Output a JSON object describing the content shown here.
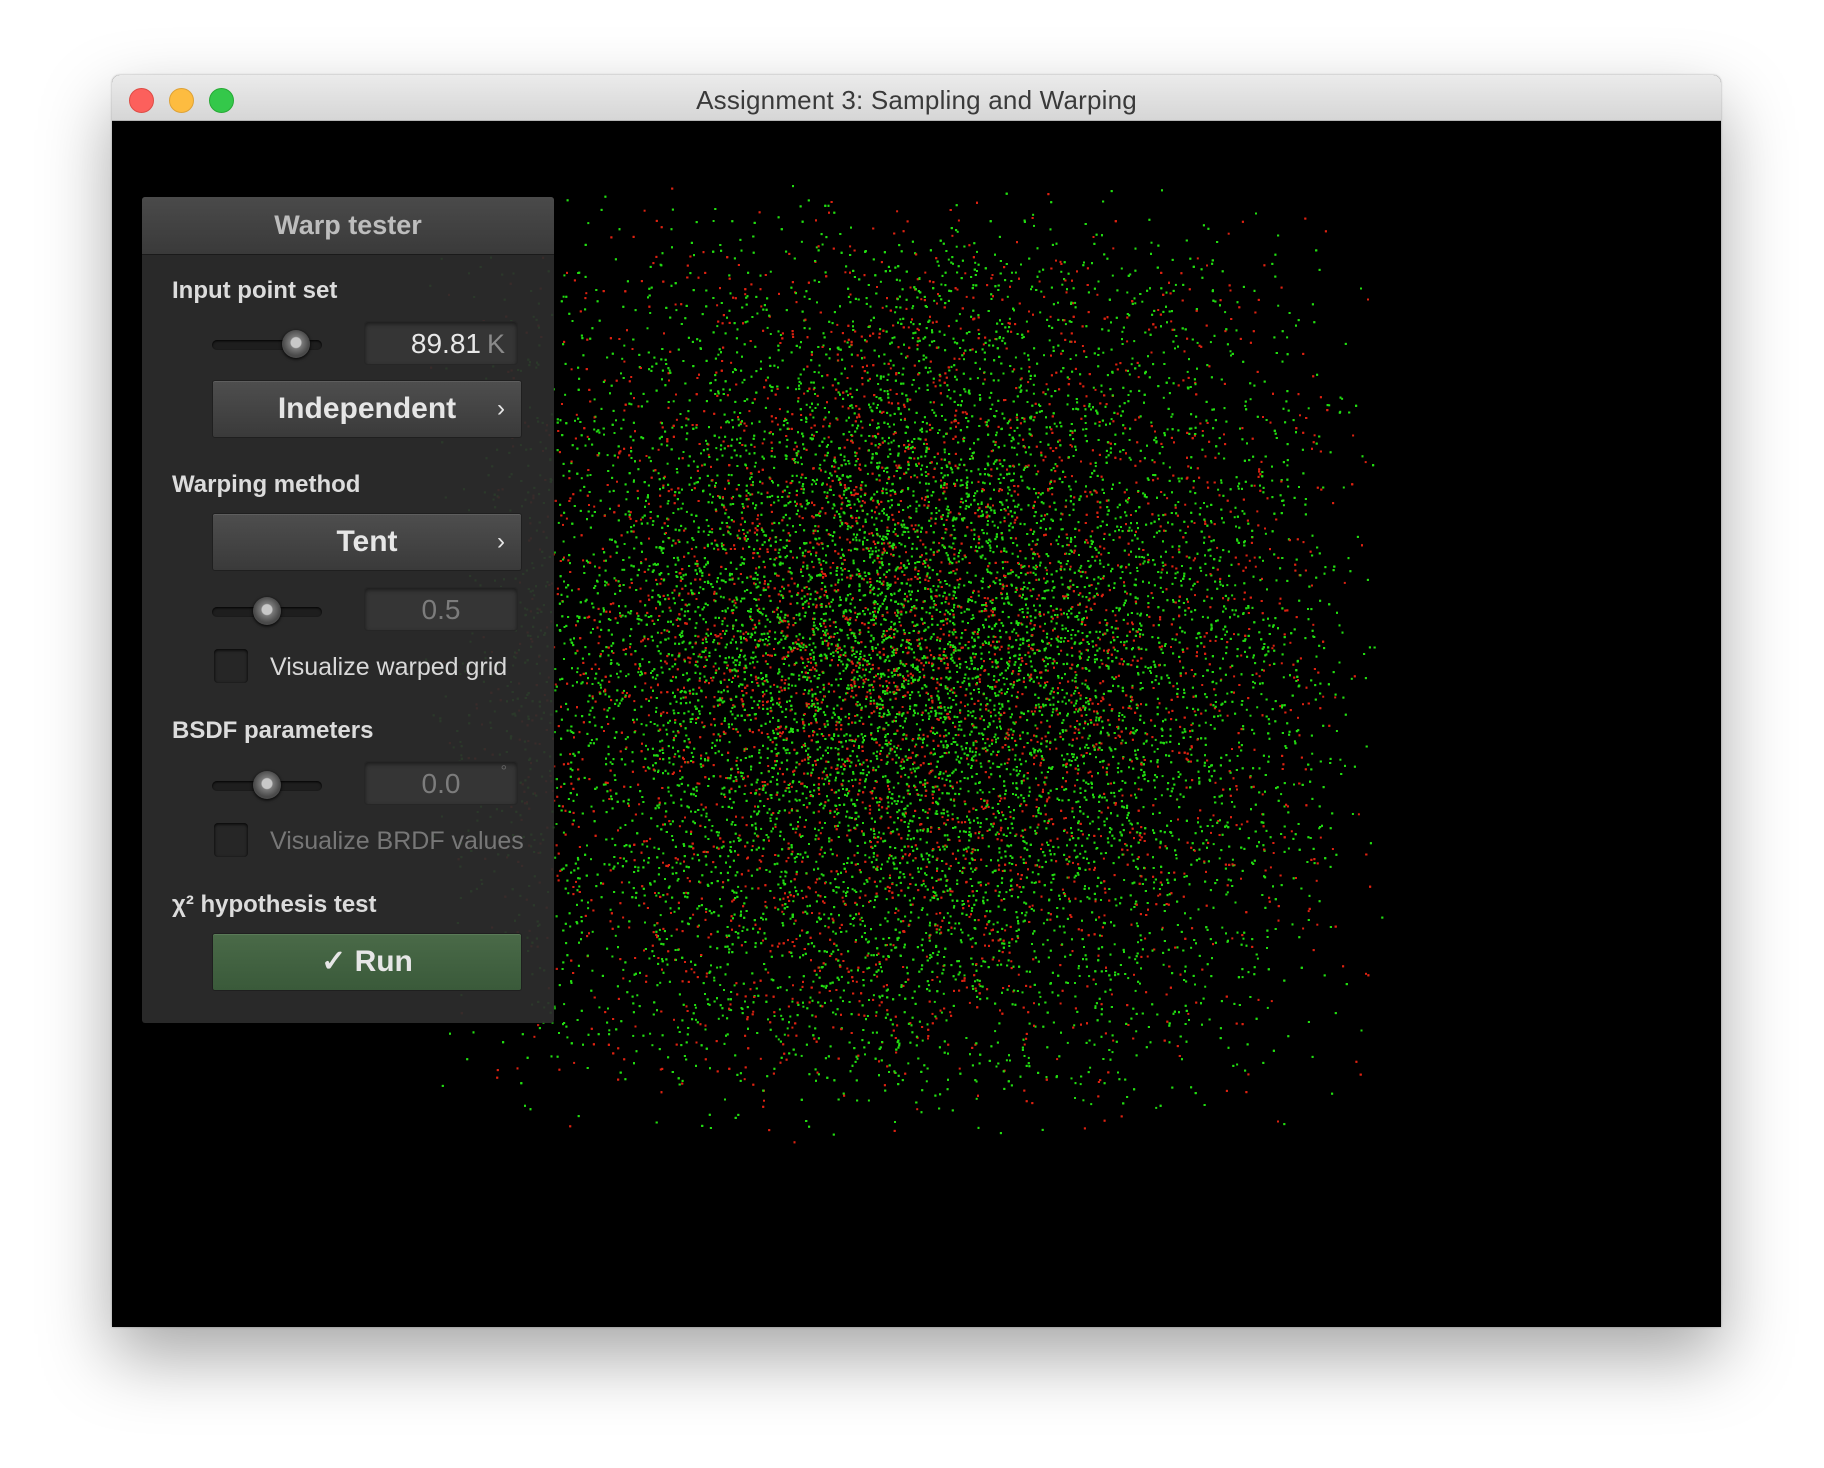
{
  "window": {
    "title": "Assignment 3: Sampling and Warping"
  },
  "panel": {
    "title": "Warp tester",
    "input_point_set": {
      "label": "Input point set",
      "count_value": "89.81",
      "count_unit": "K",
      "sampler_button": "Independent",
      "chevron": "›"
    },
    "warping_method": {
      "label": "Warping method",
      "method_button": "Tent",
      "chevron": "›",
      "parameter_value": "0.5",
      "visualize_grid_label": "Visualize warped grid",
      "visualize_grid_checked": false
    },
    "bsdf_parameters": {
      "label": "BSDF parameters",
      "angle_value": "0.0",
      "angle_unit": "°",
      "visualize_brdf_label": "Visualize BRDF values",
      "visualize_brdf_checked": false
    },
    "hypothesis_test": {
      "label": "χ² hypothesis test",
      "run_button": "✓ Run"
    }
  },
  "scatter": {
    "colors": {
      "primary": "#22dd11",
      "secondary": "#dd2211",
      "background": "#000000"
    }
  }
}
